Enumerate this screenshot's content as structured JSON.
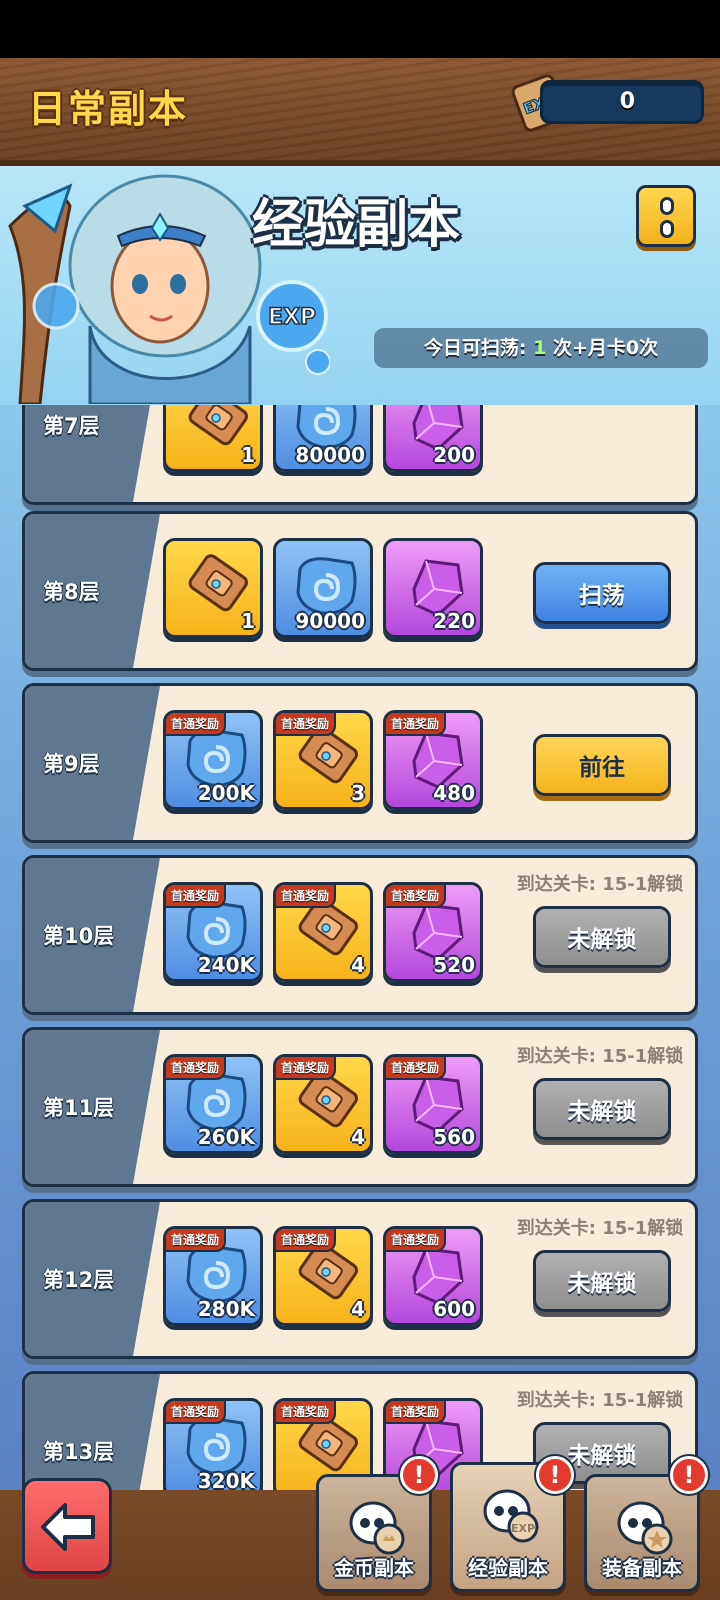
{
  "header": {
    "title": "日常副本",
    "exp_count": "0",
    "exp_icon": "exp-scroll-icon"
  },
  "banner": {
    "title": "经验副本",
    "sweep_prefix": "今日可扫荡:",
    "sweep_count": "1",
    "sweep_suffix": "次+月卡0次",
    "exp_bubble_text": "EXP"
  },
  "floors": [
    {
      "label": "第7层",
      "rewards": [
        {
          "type": "scroll",
          "qty": "1"
        },
        {
          "type": "swirl",
          "qty": "80000"
        },
        {
          "type": "gem",
          "qty": "200"
        }
      ]
    },
    {
      "label": "第8层",
      "rewards": [
        {
          "type": "scroll",
          "qty": "1"
        },
        {
          "type": "swirl",
          "qty": "90000"
        },
        {
          "type": "gem",
          "qty": "220"
        }
      ],
      "button": "扫荡"
    },
    {
      "label": "第9层",
      "rewards": [
        {
          "type": "swirl",
          "qty": "200K",
          "tag": "首通奖励"
        },
        {
          "type": "scroll",
          "qty": "3",
          "tag": "首通奖励"
        },
        {
          "type": "gem",
          "qty": "480",
          "tag": "首通奖励"
        }
      ],
      "button": "前往"
    },
    {
      "label": "第10层",
      "rewards": [
        {
          "type": "swirl",
          "qty": "240K",
          "tag": "首通奖励"
        },
        {
          "type": "scroll",
          "qty": "4",
          "tag": "首通奖励"
        },
        {
          "type": "gem",
          "qty": "520",
          "tag": "首通奖励"
        }
      ],
      "button": "未解锁",
      "hint": "到达关卡: 15-1解锁"
    },
    {
      "label": "第11层",
      "rewards": [
        {
          "type": "swirl",
          "qty": "260K",
          "tag": "首通奖励"
        },
        {
          "type": "scroll",
          "qty": "4",
          "tag": "首通奖励"
        },
        {
          "type": "gem",
          "qty": "560",
          "tag": "首通奖励"
        }
      ],
      "button": "未解锁",
      "hint": "到达关卡: 15-1解锁"
    },
    {
      "label": "第12层",
      "rewards": [
        {
          "type": "swirl",
          "qty": "280K",
          "tag": "首通奖励"
        },
        {
          "type": "scroll",
          "qty": "4",
          "tag": "首通奖励"
        },
        {
          "type": "gem",
          "qty": "600",
          "tag": "首通奖励"
        }
      ],
      "button": "未解锁",
      "hint": "到达关卡: 15-1解锁"
    },
    {
      "label": "第13层",
      "rewards": [
        {
          "type": "swirl",
          "qty": "320K",
          "tag": "首通奖励"
        },
        {
          "type": "scroll",
          "qty": "",
          "tag": "首通奖励"
        },
        {
          "type": "gem",
          "qty": "",
          "tag": "首通奖励"
        }
      ],
      "button": "未解锁",
      "hint": "到达关卡: 15-1解锁"
    }
  ],
  "tabs": [
    {
      "label": "金币副本",
      "icon": "skull-coin-icon"
    },
    {
      "label": "经验副本",
      "icon": "skull-exp-icon",
      "active": true
    },
    {
      "label": "装备副本",
      "icon": "skull-star-icon"
    }
  ],
  "alert_symbol": "!",
  "colors": {
    "wood": "#7a4a28",
    "panel_blue": "#8bc5ea",
    "card_bg": "#f6ecd9",
    "sweep_button": "#4f8de2",
    "go_button": "#f4b21c",
    "locked_button": "#9e9e9e",
    "title_yellow": "#ffd84a",
    "alert_red": "#e23a2e"
  }
}
